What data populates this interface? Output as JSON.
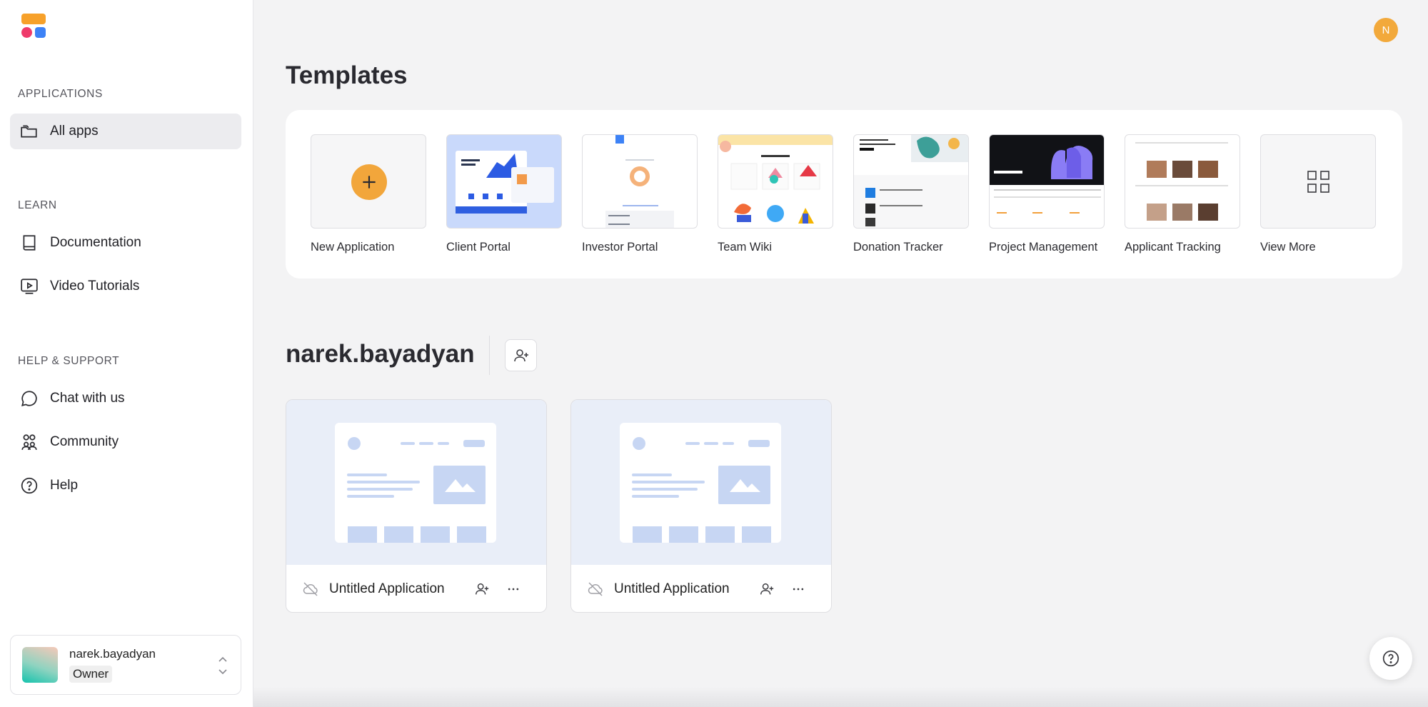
{
  "sidebar": {
    "applications_label": "APPLICATIONS",
    "all_apps": "All apps",
    "learn_label": "LEARN",
    "documentation": "Documentation",
    "video_tutorials": "Video Tutorials",
    "help_label": "HELP & SUPPORT",
    "chat": "Chat with us",
    "community": "Community",
    "help": "Help"
  },
  "account": {
    "username": "narek.bayadyan",
    "role": "Owner"
  },
  "header": {
    "avatar_initial": "N"
  },
  "templates": {
    "title": "Templates",
    "items": [
      {
        "label": "New Application"
      },
      {
        "label": "Client Portal"
      },
      {
        "label": "Investor Portal"
      },
      {
        "label": "Team Wiki"
      },
      {
        "label": "Donation Tracker"
      },
      {
        "label": "Project Management"
      },
      {
        "label": "Applicant Tracking"
      },
      {
        "label": "View More"
      }
    ]
  },
  "workspace": {
    "name": "narek.bayadyan",
    "apps": [
      {
        "name": "Untitled Application"
      },
      {
        "name": "Untitled Application"
      }
    ]
  },
  "colors": {
    "accent": "#f2a63b",
    "logo_orange": "#f7a12a",
    "logo_pink": "#ef3b6b",
    "logo_blue": "#3d82f6"
  }
}
